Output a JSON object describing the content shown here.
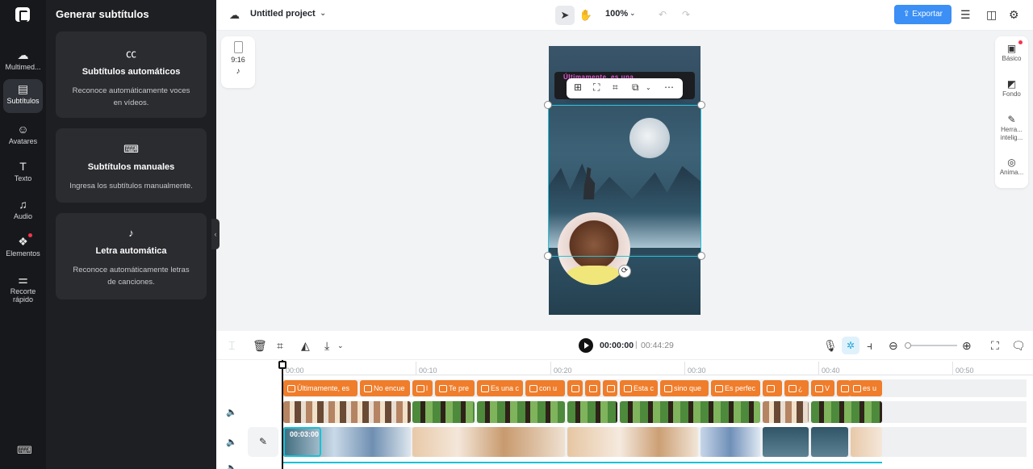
{
  "sidebar": {
    "items": [
      {
        "label": "Multimed...",
        "icon": "cloud-upload-icon"
      },
      {
        "label": "Subtítulos",
        "icon": "subtitles-icon"
      },
      {
        "label": "Avatares",
        "icon": "avatar-icon"
      },
      {
        "label": "Texto",
        "icon": "text-icon"
      },
      {
        "label": "Audio",
        "icon": "music-note-icon"
      },
      {
        "label": "Elementos",
        "icon": "elements-icon"
      },
      {
        "label": "Recorte rápido",
        "icon": "quick-cut-icon"
      }
    ]
  },
  "panel": {
    "title": "Generar subtítulos",
    "cards": [
      {
        "title": "Subtítulos automáticos",
        "desc": "Reconoce automáticamente voces en vídeos.",
        "icon": "cc-icon"
      },
      {
        "title": "Subtítulos manuales",
        "desc": "Ingresa los subtítulos manualmente.",
        "icon": "keyboard-icon"
      },
      {
        "title": "Letra automática",
        "desc": "Reconoce automáticamente letras de canciones.",
        "icon": "lyrics-icon"
      }
    ]
  },
  "topbar": {
    "project": "Untitled project",
    "zoom": "100%",
    "export": "Exportar"
  },
  "canvas": {
    "ratio": "9:16",
    "caption": "Últimamente, es una..."
  },
  "props": {
    "items": [
      {
        "label": "Básico",
        "icon": "basic-icon"
      },
      {
        "label": "Fondo",
        "icon": "background-icon"
      },
      {
        "label": "Herra... intelig...",
        "icon": "magic-wand-icon"
      },
      {
        "label": "Anima...",
        "icon": "animation-icon"
      }
    ]
  },
  "player": {
    "current": "00:00:00",
    "sep": "|",
    "duration": "00:44:29"
  },
  "timeline": {
    "ticks": [
      "00:00",
      "00:10",
      "00:20",
      "00:30",
      "00:40",
      "00:50"
    ],
    "subtitle_clips": [
      "Últimamente, es",
      "No encue",
      "l",
      "Te pre",
      "Es una c",
      "con u",
      "",
      "",
      "",
      "Esta c",
      "sino que",
      "Es perfec",
      "",
      "¿",
      "V",
      "[",
      "es u"
    ],
    "base_clip_time": "00:03:00"
  },
  "colors": {
    "accent": "#3b8ff5",
    "subtitle_clip": "#ef7d2b",
    "selection": "#16c1d6"
  }
}
